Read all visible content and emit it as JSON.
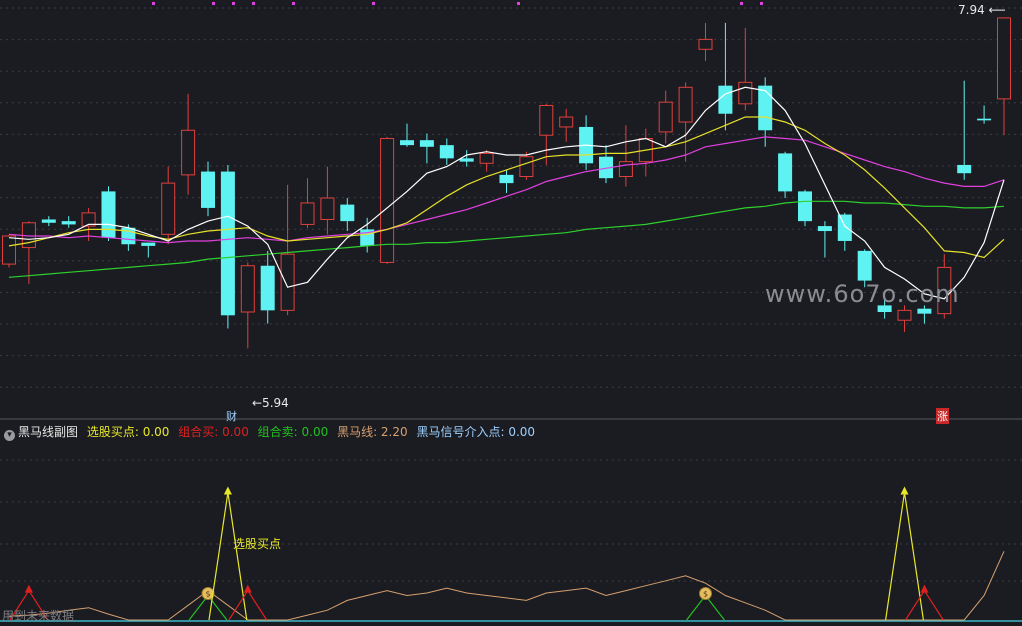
{
  "colors": {
    "up": "#e0403d",
    "down": "#5ef2f2",
    "ma5": "#ffffff",
    "ma10": "#e6e02a",
    "ma20": "#e040e0",
    "ma60": "#2ed02e",
    "grid": "#3a3c44",
    "bg": "#1b1c21",
    "sub_buy": "#e8e82a",
    "sub_combo_buy": "#e02020",
    "sub_combo_sell": "#20c020",
    "sub_heima": "#d6a070"
  },
  "price_axis": {
    "min": 5.7,
    "max": 8.0
  },
  "main_labels": {
    "high_marker": "7.94",
    "low_marker": "←5.94",
    "cai_badge": "财",
    "zhang_badge": "涨"
  },
  "sub_header": {
    "indicator_name": "黑马线副图",
    "buy_point": "选股买点: 0.00",
    "combo_buy": "组合买: 0.00",
    "combo_sell": "组合卖: 0.00",
    "heima_line": "黑马线: 2.20",
    "heima_signal": "黑马信号介入点: 0.00"
  },
  "sub_annotation": "选股买点",
  "watermark": "www.6o7o.com",
  "footer": "用到未来数据",
  "chart_data": {
    "type": "candlestick",
    "ohlc": [
      [
        6.45,
        6.62,
        6.43,
        6.63
      ],
      [
        6.55,
        6.7,
        6.33,
        6.71
      ],
      [
        6.72,
        6.7,
        6.68,
        6.74
      ],
      [
        6.71,
        6.69,
        6.67,
        6.74
      ],
      [
        6.68,
        6.76,
        6.59,
        6.79
      ],
      [
        6.89,
        6.61,
        6.59,
        6.92
      ],
      [
        6.67,
        6.57,
        6.53,
        6.69
      ],
      [
        6.58,
        6.56,
        6.49,
        6.58
      ],
      [
        6.63,
        6.94,
        6.57,
        7.04
      ],
      [
        6.99,
        7.26,
        6.87,
        7.48
      ],
      [
        7.01,
        6.79,
        6.74,
        7.07
      ],
      [
        7.01,
        6.14,
        6.06,
        7.05
      ],
      [
        6.16,
        6.44,
        5.94,
        6.46
      ],
      [
        6.44,
        6.17,
        6.09,
        6.53
      ],
      [
        6.17,
        6.51,
        6.14,
        6.93
      ],
      [
        6.69,
        6.82,
        6.67,
        6.97
      ],
      [
        6.72,
        6.85,
        6.63,
        7.04
      ],
      [
        6.81,
        6.71,
        6.65,
        6.85
      ],
      [
        6.66,
        6.56,
        6.52,
        6.73
      ],
      [
        6.46,
        7.21,
        6.45,
        7.22
      ],
      [
        7.2,
        7.17,
        7.16,
        7.3
      ],
      [
        7.2,
        7.16,
        7.06,
        7.24
      ],
      [
        7.17,
        7.09,
        7.05,
        7.21
      ],
      [
        7.09,
        7.07,
        7.04,
        7.14
      ],
      [
        7.06,
        7.12,
        7.01,
        7.14
      ],
      [
        6.99,
        6.94,
        6.88,
        7.02
      ],
      [
        6.98,
        7.1,
        6.96,
        7.13
      ],
      [
        7.23,
        7.41,
        7.05,
        7.42
      ],
      [
        7.28,
        7.34,
        7.19,
        7.39
      ],
      [
        7.28,
        7.06,
        7.02,
        7.35
      ],
      [
        7.1,
        6.97,
        6.94,
        7.17
      ],
      [
        6.98,
        7.07,
        6.92,
        7.29
      ],
      [
        7.07,
        7.21,
        6.98,
        7.27
      ],
      [
        7.25,
        7.43,
        7.18,
        7.5
      ],
      [
        7.31,
        7.52,
        7.07,
        7.55
      ],
      [
        7.75,
        7.81,
        7.68,
        7.91
      ],
      [
        7.53,
        7.36,
        7.26,
        7.91
      ],
      [
        7.42,
        7.55,
        7.38,
        7.88
      ],
      [
        7.53,
        7.26,
        7.16,
        7.58
      ],
      [
        7.12,
        6.89,
        6.85,
        7.13
      ],
      [
        6.89,
        6.71,
        6.68,
        6.9
      ],
      [
        6.68,
        6.65,
        6.49,
        6.71
      ],
      [
        6.75,
        6.59,
        6.53,
        6.76
      ],
      [
        6.53,
        6.35,
        6.31,
        6.54
      ],
      [
        6.2,
        6.16,
        6.12,
        6.24
      ],
      [
        6.11,
        6.17,
        6.04,
        6.2
      ],
      [
        6.18,
        6.15,
        6.09,
        6.2
      ],
      [
        6.15,
        6.43,
        6.12,
        6.51
      ],
      [
        7.05,
        7.0,
        6.96,
        7.56
      ],
      [
        7.33,
        7.32,
        7.3,
        7.41
      ],
      [
        7.45,
        7.94,
        7.23,
        7.94
      ]
    ],
    "ma5": [
      6.61,
      6.6,
      6.61,
      6.63,
      6.69,
      6.69,
      6.67,
      6.63,
      6.59,
      6.66,
      6.71,
      6.74,
      6.68,
      6.57,
      6.31,
      6.34,
      6.48,
      6.61,
      6.69,
      6.79,
      6.89,
      7.0,
      7.04,
      7.11,
      7.13,
      7.11,
      7.11,
      7.14,
      7.16,
      7.17,
      7.16,
      7.19,
      7.21,
      7.16,
      7.23,
      7.38,
      7.48,
      7.52,
      7.5,
      7.38,
      7.18,
      6.93,
      6.68,
      6.59,
      6.43,
      6.36,
      6.27,
      6.24,
      6.37,
      6.58,
      6.96
    ],
    "ma10": [
      6.56,
      6.58,
      6.61,
      6.64,
      6.66,
      6.66,
      6.65,
      6.62,
      6.6,
      6.63,
      6.65,
      6.66,
      6.67,
      6.62,
      6.59,
      6.6,
      6.61,
      6.62,
      6.63,
      6.66,
      6.7,
      6.78,
      6.86,
      6.93,
      6.98,
      7.02,
      7.06,
      7.1,
      7.11,
      7.11,
      7.12,
      7.12,
      7.14,
      7.16,
      7.19,
      7.24,
      7.29,
      7.34,
      7.34,
      7.31,
      7.26,
      7.18,
      7.11,
      7.02,
      6.91,
      6.79,
      6.67,
      6.53,
      6.52,
      6.49,
      6.6
    ],
    "ma20": [
      6.63,
      6.62,
      6.62,
      6.61,
      6.62,
      6.61,
      6.6,
      6.59,
      6.58,
      6.59,
      6.59,
      6.6,
      6.61,
      6.6,
      6.59,
      6.61,
      6.62,
      6.63,
      6.64,
      6.66,
      6.69,
      6.72,
      6.75,
      6.78,
      6.82,
      6.86,
      6.9,
      6.95,
      6.98,
      7.01,
      7.03,
      7.05,
      7.06,
      7.08,
      7.11,
      7.16,
      7.18,
      7.2,
      7.22,
      7.21,
      7.2,
      7.16,
      7.12,
      7.08,
      7.04,
      7.01,
      6.97,
      6.94,
      6.92,
      6.92,
      6.96
    ],
    "ma60": [
      6.37,
      6.38,
      6.39,
      6.4,
      6.41,
      6.42,
      6.43,
      6.44,
      6.45,
      6.46,
      6.48,
      6.49,
      6.5,
      6.51,
      6.52,
      6.53,
      6.54,
      6.55,
      6.56,
      6.57,
      6.57,
      6.58,
      6.58,
      6.59,
      6.6,
      6.61,
      6.62,
      6.63,
      6.64,
      6.66,
      6.67,
      6.68,
      6.69,
      6.71,
      6.73,
      6.75,
      6.77,
      6.79,
      6.8,
      6.82,
      6.83,
      6.83,
      6.83,
      6.82,
      6.82,
      6.81,
      6.8,
      6.8,
      6.79,
      6.79,
      6.8
    ],
    "sub_axis": {
      "min": 0,
      "max": 3.2
    },
    "sub_series": {
      "heima_line": [
        0.08,
        0.1,
        0.14,
        0.2,
        0.25,
        0.12,
        0.0,
        0.0,
        0.0,
        0.3,
        0.6,
        0.3,
        0.0,
        0.0,
        0.0,
        0.1,
        0.2,
        0.4,
        0.5,
        0.6,
        0.5,
        0.55,
        0.65,
        0.55,
        0.5,
        0.45,
        0.4,
        0.55,
        0.6,
        0.65,
        0.5,
        0.6,
        0.7,
        0.8,
        0.9,
        0.75,
        0.5,
        0.35,
        0.2,
        0.0,
        0.0,
        0.0,
        0.0,
        0.0,
        0.0,
        0.0,
        0.0,
        0.0,
        0.0,
        0.5,
        1.4
      ],
      "buy_points": [
        {
          "index": 11,
          "value": 2.6
        },
        {
          "index": 45,
          "value": 2.6
        }
      ],
      "combo_buy_points": [
        {
          "index": 1,
          "value": 0.6
        },
        {
          "index": 12,
          "value": 0.6
        },
        {
          "index": 46,
          "value": 0.6
        }
      ],
      "combo_sell_points": [
        {
          "index": 10,
          "value": 0.5
        },
        {
          "index": 35,
          "value": 0.5
        }
      ]
    }
  }
}
